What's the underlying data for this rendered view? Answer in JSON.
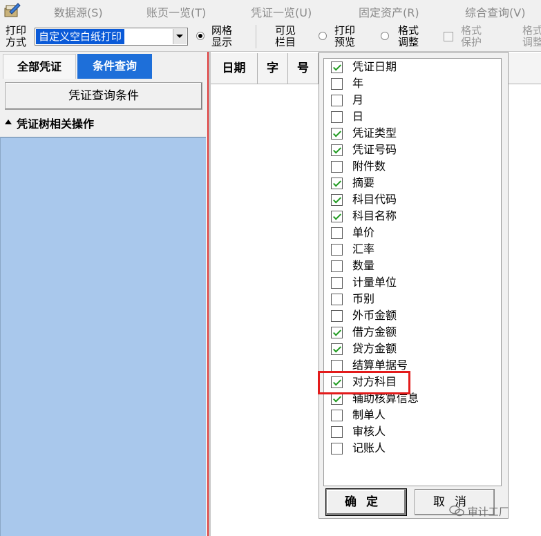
{
  "menu": {
    "items": [
      {
        "label": "数据源(S)"
      },
      {
        "label": "账页一览(T)"
      },
      {
        "label": "凭证一览(U)"
      },
      {
        "label": "固定资产(R)"
      },
      {
        "label": "综合查询(V)"
      }
    ]
  },
  "toolbar": {
    "print_mode_label": "打印\n方式",
    "print_mode_value": "自定义空白纸打印",
    "grid_display_label": "网格\n显示",
    "visible_columns_label": "可见\n栏目",
    "print_preview_label": "打印\n预览",
    "format_adjust_label": "格式\n调整",
    "format_protect_label": "格式\n保护",
    "format_adjust2_label": "格式\n调整"
  },
  "left": {
    "tabs": [
      {
        "label": "全部凭证",
        "active": false
      },
      {
        "label": "条件查询",
        "active": true
      }
    ],
    "query_button": "凭证查询条件",
    "tree_header": "凭证树相关操作"
  },
  "grid": {
    "columns": [
      {
        "label": "日期"
      },
      {
        "label": "字"
      },
      {
        "label": "号"
      }
    ]
  },
  "dialog": {
    "items": [
      {
        "label": "凭证日期",
        "checked": true
      },
      {
        "label": "年",
        "checked": false
      },
      {
        "label": "月",
        "checked": false
      },
      {
        "label": "日",
        "checked": false
      },
      {
        "label": "凭证类型",
        "checked": true
      },
      {
        "label": "凭证号码",
        "checked": true
      },
      {
        "label": "附件数",
        "checked": false
      },
      {
        "label": "摘要",
        "checked": true
      },
      {
        "label": "科目代码",
        "checked": true
      },
      {
        "label": "科目名称",
        "checked": true
      },
      {
        "label": "单价",
        "checked": false
      },
      {
        "label": "汇率",
        "checked": false
      },
      {
        "label": "数量",
        "checked": false
      },
      {
        "label": "计量单位",
        "checked": false
      },
      {
        "label": "币别",
        "checked": false
      },
      {
        "label": "外币金额",
        "checked": false
      },
      {
        "label": "借方金额",
        "checked": true
      },
      {
        "label": "贷方金额",
        "checked": true
      },
      {
        "label": "结算单据号",
        "checked": false
      },
      {
        "label": "对方科目",
        "checked": true
      },
      {
        "label": "辅助核算信息",
        "checked": true
      },
      {
        "label": "制单人",
        "checked": false
      },
      {
        "label": "审核人",
        "checked": false
      },
      {
        "label": "记账人",
        "checked": false
      }
    ],
    "ok_label": "确定",
    "cancel_label": "取消"
  },
  "watermark": "审计工厂",
  "colors": {
    "active_tab": "#1e6fd9",
    "tree_background": "#a9c8ec",
    "highlight": "#e31b1b",
    "check": "#1f9a1f"
  }
}
